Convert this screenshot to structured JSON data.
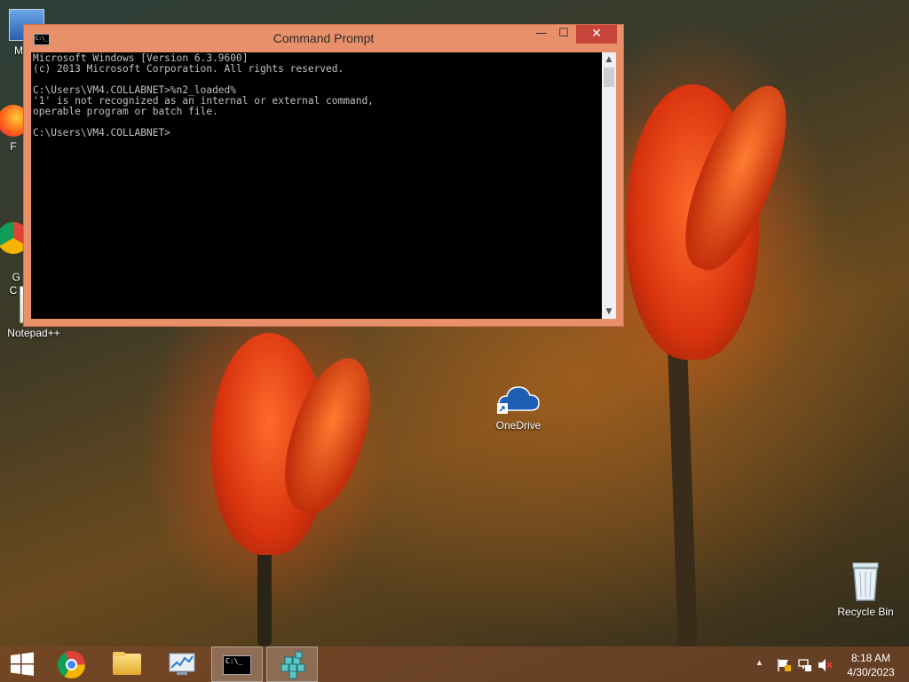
{
  "desktop": {
    "icons": [
      {
        "label": "My C"
      },
      {
        "label": "F"
      },
      {
        "label": "G\nC"
      },
      {
        "label": "Notepad++"
      },
      {
        "label": "OneDrive"
      },
      {
        "label": "Recycle Bin"
      }
    ]
  },
  "cmd_window": {
    "title": "Command Prompt",
    "app_icon_text": "C:\\_",
    "controls": {
      "minimize": "—",
      "maximize": "☐",
      "close": "✕"
    },
    "lines": [
      "Microsoft Windows [Version 6.3.9600]",
      "(c) 2013 Microsoft Corporation. All rights reserved.",
      "",
      "C:\\Users\\VM4.COLLABNET>%n2_loaded%",
      "'1' is not recognized as an internal or external command,",
      "operable program or batch file.",
      "",
      "C:\\Users\\VM4.COLLABNET>"
    ]
  },
  "taskbar": {
    "items": [
      "Start",
      "Google Chrome",
      "File Explorer",
      "Performance Monitor",
      "Command Prompt",
      "Remote App"
    ],
    "active": "Command Prompt"
  },
  "tray": {
    "time": "8:18 AM",
    "date": "4/30/2023"
  }
}
